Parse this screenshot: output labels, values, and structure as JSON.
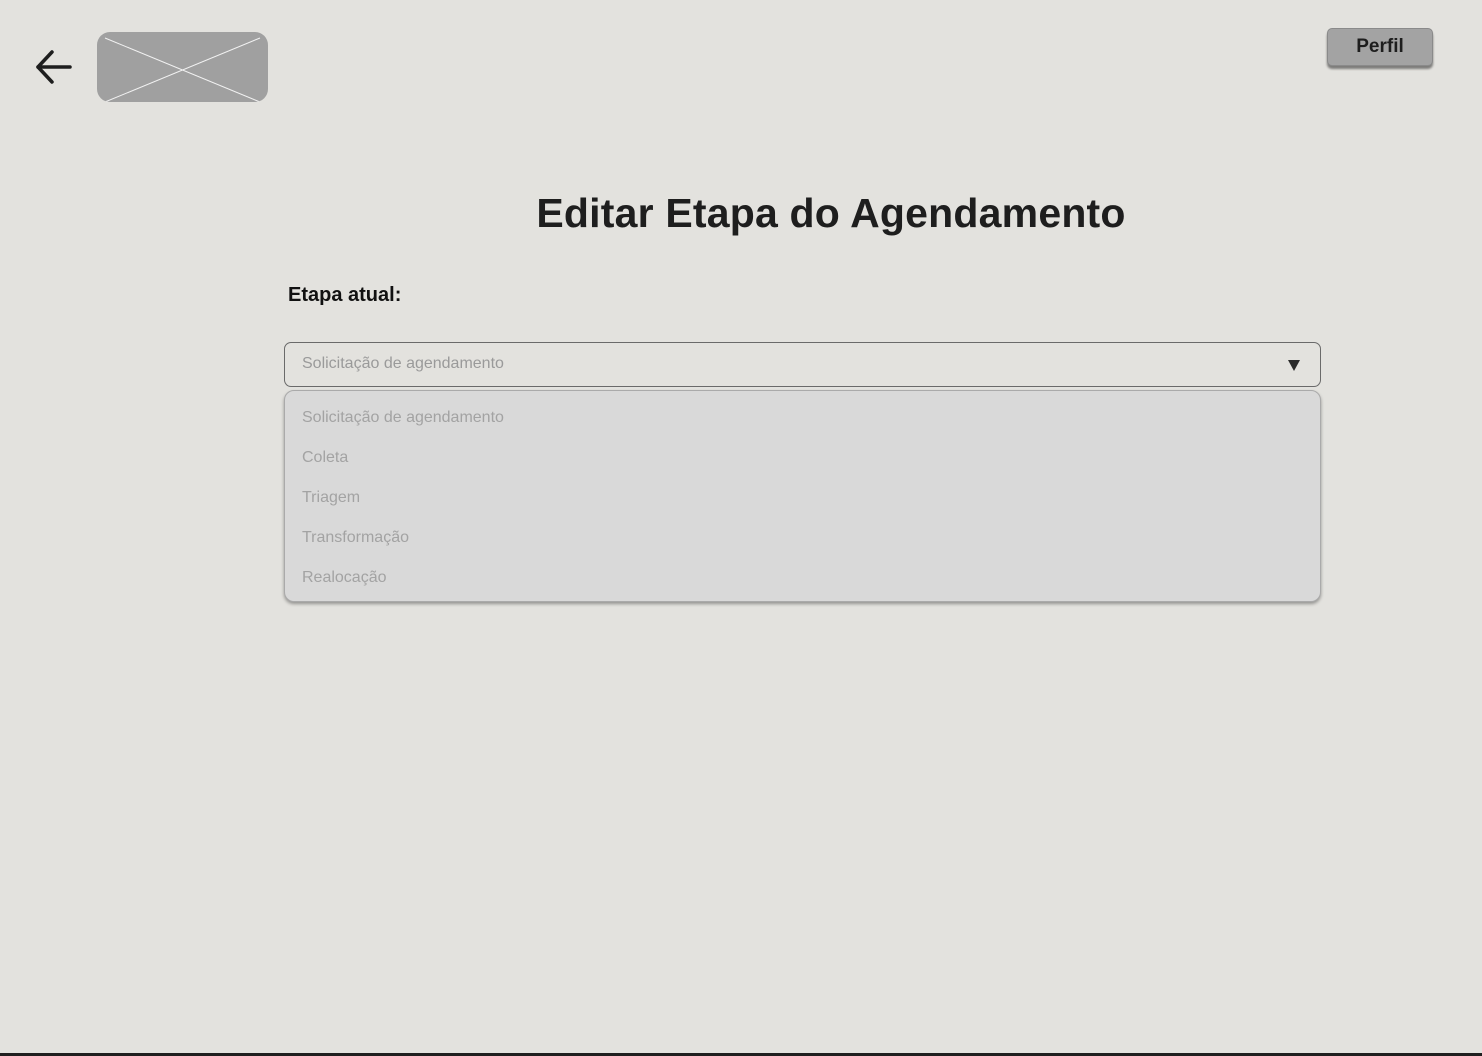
{
  "header": {
    "back_icon": "arrow-left-icon",
    "logo_icon": "image-placeholder-icon",
    "profile_label": "Perfil"
  },
  "main": {
    "title": "Editar Etapa do Agendamento",
    "field_label": "Etapa atual:",
    "select": {
      "value": "Solicitação de agendamento",
      "arrow_icon": "triangle-down-icon",
      "options": [
        "Solicitação de agendamento",
        "Coleta",
        "Triagem",
        "Transformação",
        "Realocação"
      ]
    }
  },
  "colors": {
    "background": "#e3e2de",
    "placeholder_gray": "#a0a0a0",
    "dropdown_background": "#d9d9d9",
    "muted_text": "#9a9a9a"
  }
}
